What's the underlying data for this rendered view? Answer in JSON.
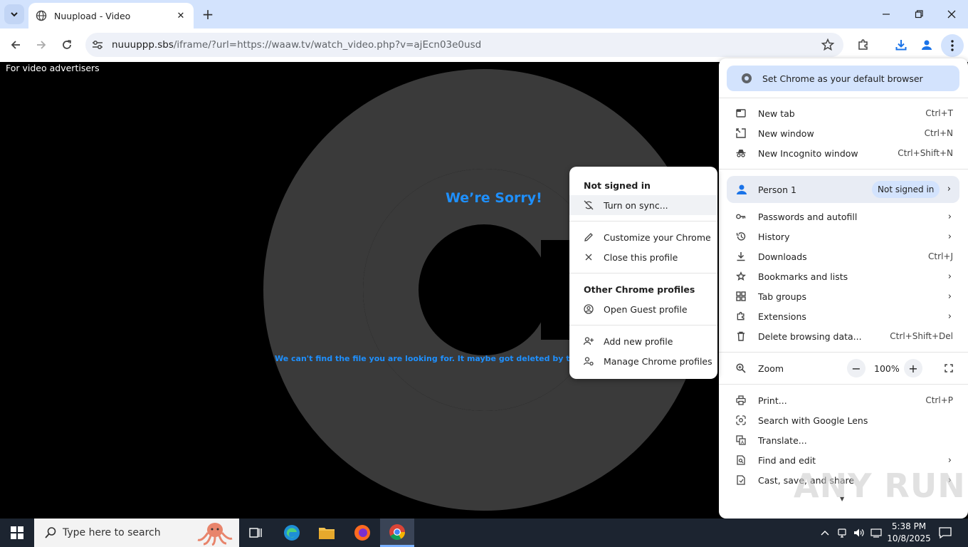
{
  "browser": {
    "tab_title": "Nuupload - Video",
    "url_host": "nuuuppp.sbs",
    "url_path": "/iframe/?url=https://waaw.tv/watch_video.php?v=ajEcn03e0usd"
  },
  "page": {
    "advertisers_text": "For video advertisers",
    "sorry_heading": "We’re Sorry!",
    "error_text": "We can't find the file you are looking for. It maybe got deleted by the owner or was"
  },
  "menu": {
    "default_banner": "Set Chrome as your default browser",
    "new_tab": {
      "label": "New tab",
      "shortcut": "Ctrl+T"
    },
    "new_window": {
      "label": "New window",
      "shortcut": "Ctrl+N"
    },
    "incognito": {
      "label": "New Incognito window",
      "shortcut": "Ctrl+Shift+N"
    },
    "person": {
      "label": "Person 1",
      "status": "Not signed in"
    },
    "passwords": {
      "label": "Passwords and autofill"
    },
    "history": {
      "label": "History"
    },
    "downloads": {
      "label": "Downloads",
      "shortcut": "Ctrl+J"
    },
    "bookmarks": {
      "label": "Bookmarks and lists"
    },
    "tab_groups": {
      "label": "Tab groups"
    },
    "extensions": {
      "label": "Extensions"
    },
    "delete_data": {
      "label": "Delete browsing data...",
      "shortcut": "Ctrl+Shift+Del"
    },
    "zoom": {
      "label": "Zoom",
      "value": "100%"
    },
    "print": {
      "label": "Print...",
      "shortcut": "Ctrl+P"
    },
    "lens": {
      "label": "Search with Google Lens"
    },
    "translate": {
      "label": "Translate..."
    },
    "find_edit": {
      "label": "Find and edit"
    },
    "cast_save": {
      "label": "Cast, save, and share"
    }
  },
  "submenu": {
    "header": "Not signed in",
    "turn_on_sync": "Turn on sync...",
    "customize": "Customize your Chrome",
    "close_profile": "Close this profile",
    "other_header": "Other Chrome profiles",
    "guest": "Open Guest profile",
    "add_profile": "Add new profile",
    "manage_profiles": "Manage Chrome profiles"
  },
  "watermark": "ANY RUN",
  "taskbar": {
    "search_placeholder": "Type here to search",
    "time": "5:38 PM",
    "date": "10/8/2025"
  },
  "colors": {
    "accent_blue": "#1e90ff",
    "titlebar": "#d3e3fd",
    "taskbar": "#1c2430"
  }
}
